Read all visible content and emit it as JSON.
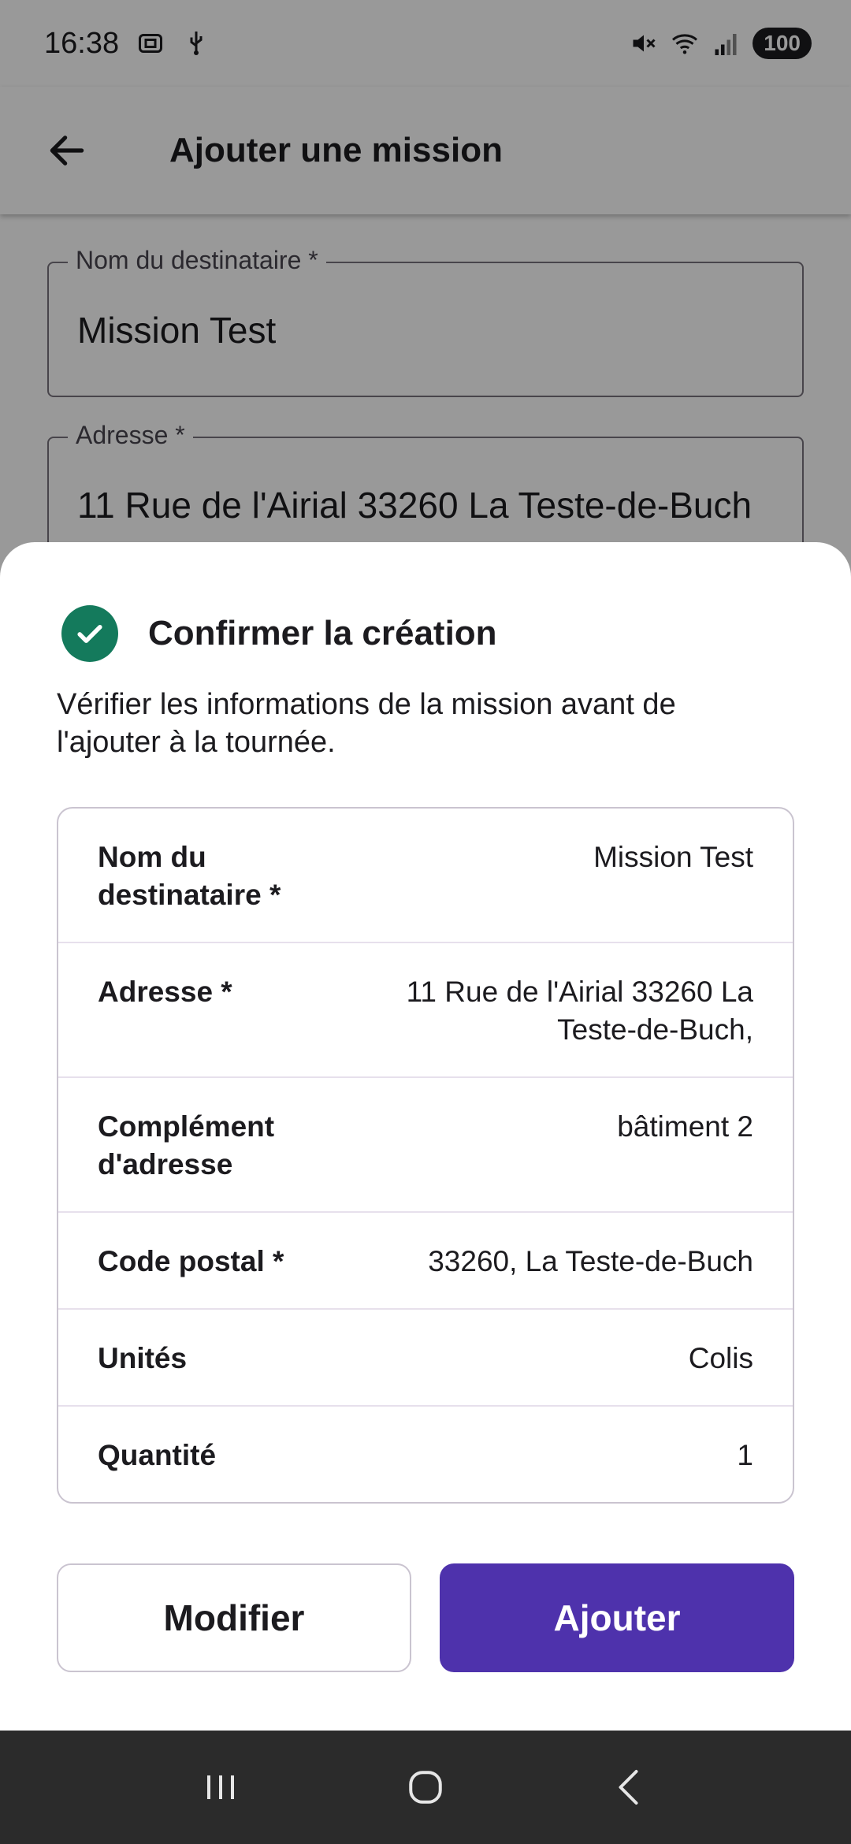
{
  "status_bar": {
    "time": "16:38",
    "battery": "100",
    "icons": [
      "screenshot-icon",
      "usb-icon",
      "mute-icon",
      "wifi-icon",
      "signal-icon",
      "battery-icon"
    ]
  },
  "app_bar": {
    "title": "Ajouter une mission",
    "back_icon": "arrow-back-icon"
  },
  "form": {
    "recipient_label": "Nom du destinataire *",
    "recipient_value": "Mission Test",
    "address_label": "Adresse *",
    "address_value": "11 Rue de l'Airial 33260 La Teste-de-Buch"
  },
  "sheet": {
    "icon": "check-circle-icon",
    "title": "Confirmer la création",
    "description": "Vérifier les informations de la mission avant de l'ajouter à la tournée.",
    "rows": [
      {
        "label": "Nom du destinataire *",
        "value": "Mission Test"
      },
      {
        "label": "Adresse *",
        "value": "11 Rue de l'Airial 33260 La Teste-de-Buch,"
      },
      {
        "label": "Complément d'adresse",
        "value": "bâtiment 2"
      },
      {
        "label": "Code postal *",
        "value": "33260, La Teste-de-Buch"
      },
      {
        "label": "Unités",
        "value": "Colis"
      },
      {
        "label": "Quantité",
        "value": "1"
      }
    ],
    "modify_label": "Modifier",
    "add_label": "Ajouter"
  },
  "nav_bar": {
    "icons": [
      "recents-icon",
      "home-icon",
      "back-icon"
    ]
  },
  "colors": {
    "primary": "#4e32ac",
    "success": "#147a5c",
    "scrim": "#000000"
  }
}
